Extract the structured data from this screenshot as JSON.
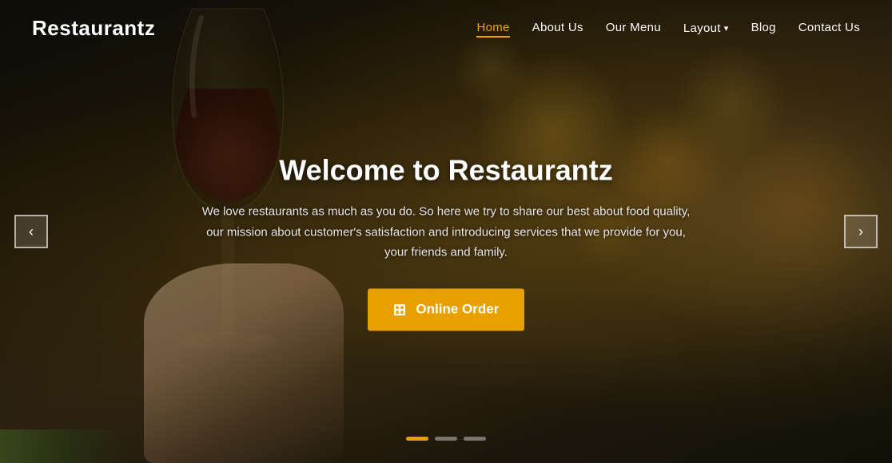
{
  "brand": {
    "logo": "Restaurantz"
  },
  "navbar": {
    "links": [
      {
        "id": "home",
        "label": "Home",
        "active": true
      },
      {
        "id": "about",
        "label": "About Us",
        "active": false
      },
      {
        "id": "menu",
        "label": "Our Menu",
        "active": false
      },
      {
        "id": "layout",
        "label": "Layout",
        "active": false,
        "dropdown": true
      },
      {
        "id": "blog",
        "label": "Blog",
        "active": false
      },
      {
        "id": "contact",
        "label": "Contact Us",
        "active": false
      }
    ]
  },
  "hero": {
    "title": "Welcome to Restaurantz",
    "subtitle": "We love restaurants as much as you do. So here we try to share our best about food quality, our mission about customer's satisfaction and introducing services that we provide for you, your friends and family.",
    "cta_label": "Online Order",
    "cta_icon": "🍽"
  },
  "arrows": {
    "prev": "‹",
    "next": "›"
  },
  "dots": [
    {
      "id": 1,
      "active": true
    },
    {
      "id": 2,
      "active": false
    },
    {
      "id": 3,
      "active": false
    }
  ],
  "colors": {
    "accent": "#e8a000",
    "active_nav": "#f0a500",
    "bg_dark": "#0d0c08"
  }
}
